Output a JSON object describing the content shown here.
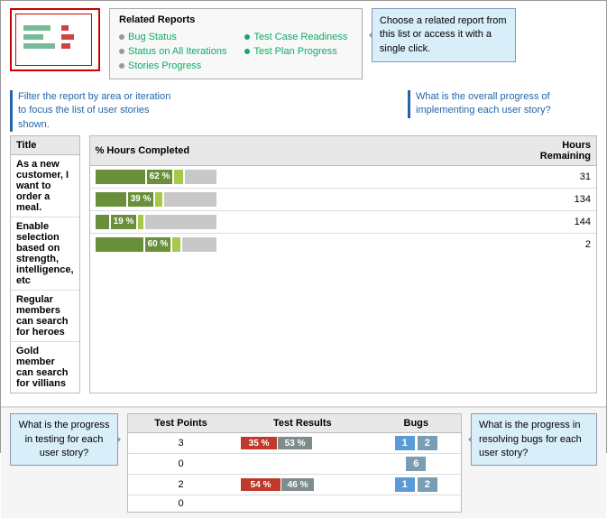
{
  "relatedReports": {
    "title": "Related Reports",
    "items": [
      {
        "label": "Bug Status",
        "col": 0
      },
      {
        "label": "Status on All Iterations",
        "col": 0
      },
      {
        "label": "Stories Progress",
        "col": 0
      },
      {
        "label": "Test Case Readiness",
        "col": 1
      },
      {
        "label": "Test Plan Progress",
        "col": 1
      }
    ]
  },
  "callout": {
    "choose": "Choose a related report from this list or access it with a single click."
  },
  "filterCallout": "Filter the report by area or iteration to focus the list of user stories shown.",
  "progressCallout": "What is the overall progress of implementing each user story?",
  "storiesTable": {
    "titleCol": "Title",
    "rows": [
      "As a new customer, I want to order a meal.",
      "Enable selection based on strength, intelligence, etc",
      "Regular members can search for heroes",
      "Gold member can search for villians"
    ]
  },
  "progressTable": {
    "colHours": "% Hours Completed",
    "colRemaining": "Hours\nRemaining",
    "rows": [
      {
        "percent": 62,
        "darkW": 55,
        "lightW": 10,
        "grayW": 35,
        "remaining": 31
      },
      {
        "percent": 39,
        "darkW": 34,
        "lightW": 8,
        "grayW": 58,
        "remaining": 134
      },
      {
        "percent": 19,
        "darkW": 15,
        "lightW": 6,
        "grayW": 79,
        "remaining": 144
      },
      {
        "percent": 60,
        "darkW": 53,
        "lightW": 9,
        "grayW": 38,
        "remaining": 2
      }
    ]
  },
  "testTable": {
    "col1": "Test Points",
    "col2": "Test Results",
    "col3": "Bugs",
    "rows": [
      {
        "points": 3,
        "bar1pct": "35 %",
        "bar1w": 40,
        "bar2pct": "53 %",
        "bar2w": 38,
        "bug1": 1,
        "bug2": 2
      },
      {
        "points": 0,
        "bar1pct": "",
        "bar1w": 0,
        "bar2pct": "",
        "bar2w": 0,
        "bug1": null,
        "bug2": 6
      },
      {
        "points": 2,
        "bar1pct": "54 %",
        "bar1w": 44,
        "bar2pct": "46 %",
        "bar2w": 36,
        "bug1": 1,
        "bug2": 2
      },
      {
        "points": 0,
        "bar1pct": "",
        "bar1w": 0,
        "bar2pct": "",
        "bar2w": 0,
        "bug1": null,
        "bug2": null
      }
    ]
  },
  "bottomCalloutLeft": "What is the progress in testing for each user story?",
  "bottomCalloutRight": "What is the progress in resolving bugs for each user story?"
}
